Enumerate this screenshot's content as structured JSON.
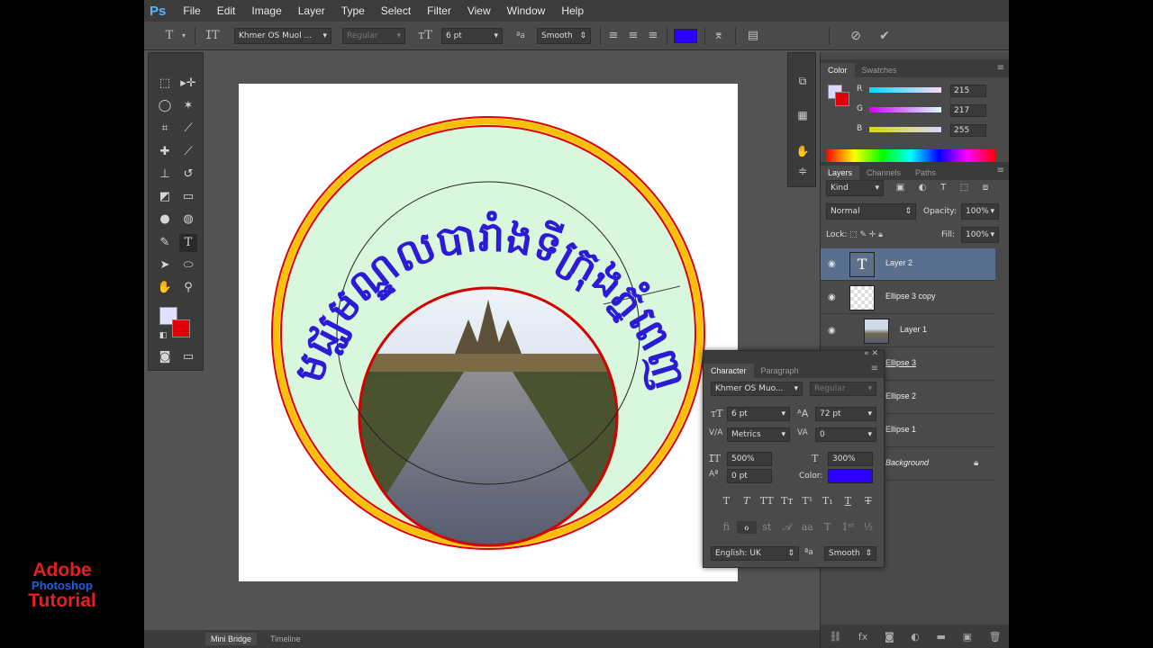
{
  "watermark": {
    "line1": "Adobe",
    "line2": "Photoshop",
    "line3": "Tutorial"
  },
  "app": {
    "logo": "Ps"
  },
  "menu": [
    "File",
    "Edit",
    "Image",
    "Layer",
    "Type",
    "Select",
    "Filter",
    "View",
    "Window",
    "Help"
  ],
  "options": {
    "font_family": "Khmer OS Muol ...",
    "font_style": "Regular",
    "font_size": "6 pt",
    "antialias": "Smooth",
    "aa_label": "ªa",
    "text_color": "#2b00ff"
  },
  "color_panel": {
    "tabs": [
      "Color",
      "Swatches"
    ],
    "r_label": "R",
    "g_label": "G",
    "b_label": "B",
    "r": "215",
    "g": "217",
    "b": "255",
    "fg_color": "#d7d9ff",
    "bg_color": "#e0000a"
  },
  "layers_panel": {
    "tabs": [
      "Layers",
      "Channels",
      "Paths"
    ],
    "kind": "Kind",
    "blend_mode": "Normal",
    "opacity_label": "Opacity:",
    "opacity": "100%",
    "lock_label": "Lock:",
    "fill_label": "Fill:",
    "fill": "100%",
    "layers": [
      {
        "name": "Layer 2",
        "type": "text",
        "selected": true
      },
      {
        "name": "Ellipse 3 copy",
        "type": "shape"
      },
      {
        "name": "Layer 1",
        "type": "image"
      },
      {
        "name": "Ellipse 3",
        "type": "shape"
      },
      {
        "name": "Ellipse 2",
        "type": "shape"
      },
      {
        "name": "Ellipse 1",
        "type": "shape"
      },
      {
        "name": "Background",
        "type": "background",
        "locked": true
      }
    ]
  },
  "character_panel": {
    "tabs": [
      "Character",
      "Paragraph"
    ],
    "font_family": "Khmer OS Muo...",
    "font_style": "Regular",
    "size": "6 pt",
    "leading": "72 pt",
    "kerning": "Metrics",
    "tracking": "0",
    "vertical_scale": "500%",
    "horizontal_scale": "300%",
    "baseline_shift": "0 pt",
    "color_label": "Color:",
    "color": "#2b00ff",
    "language": "English: UK",
    "antialias": "Smooth"
  },
  "bottom_tabs": [
    "Mini Bridge",
    "Timeline"
  ],
  "artwork": {
    "curved_text": "មជ្ឈមណ្ឌលបារាំងទីក្រុងភ្នំពេញ",
    "ring_color_outer": "#ffc000",
    "ring_stroke": "#e10000",
    "ring_fill": "#d9f7dc",
    "text_color": "#2b1bd6"
  }
}
